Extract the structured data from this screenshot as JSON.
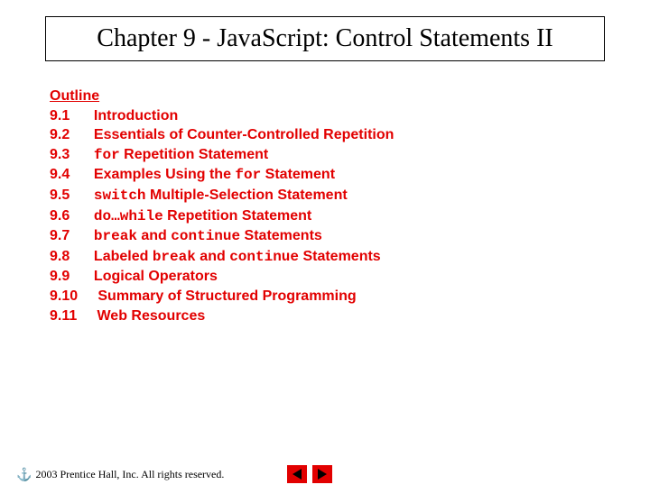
{
  "title": "Chapter 9 - JavaScript: Control Statements II",
  "outline_heading": "Outline",
  "outline": [
    {
      "num": "9.1",
      "parts": [
        {
          "t": "Introduction",
          "m": false
        }
      ]
    },
    {
      "num": "9.2",
      "parts": [
        {
          "t": "Essentials of Counter-Controlled Repetition",
          "m": false
        }
      ]
    },
    {
      "num": "9.3",
      "parts": [
        {
          "t": "for",
          "m": true
        },
        {
          "t": " Repetition Statement",
          "m": false
        }
      ]
    },
    {
      "num": "9.4",
      "parts": [
        {
          "t": "Examples Using the ",
          "m": false
        },
        {
          "t": "for",
          "m": true
        },
        {
          "t": " Statement",
          "m": false
        }
      ]
    },
    {
      "num": "9.5",
      "parts": [
        {
          "t": "switch",
          "m": true
        },
        {
          "t": " Multiple-Selection Statement",
          "m": false
        }
      ]
    },
    {
      "num": "9.6",
      "parts": [
        {
          "t": "do…while",
          "m": true
        },
        {
          "t": " Repetition Statement",
          "m": false
        }
      ]
    },
    {
      "num": "9.7",
      "parts": [
        {
          "t": "break",
          "m": true
        },
        {
          "t": " and ",
          "m": false
        },
        {
          "t": "continue",
          "m": true
        },
        {
          "t": " Statements",
          "m": false
        }
      ]
    },
    {
      "num": "9.8",
      "parts": [
        {
          "t": "Labeled ",
          "m": false
        },
        {
          "t": "break",
          "m": true
        },
        {
          "t": " and ",
          "m": false
        },
        {
          "t": "continue",
          "m": true
        },
        {
          "t": " Statements",
          "m": false
        }
      ]
    },
    {
      "num": "9.9",
      "parts": [
        {
          "t": "Logical Operators",
          "m": false
        }
      ]
    },
    {
      "num": "9.10",
      "parts": [
        {
          "t": "Summary of Structured Programming",
          "m": false
        }
      ]
    },
    {
      "num": "9.11",
      "parts": [
        {
          "t": "Web Resources",
          "m": false
        }
      ]
    }
  ],
  "copyright": "2003 Prentice Hall, Inc.  All rights reserved."
}
